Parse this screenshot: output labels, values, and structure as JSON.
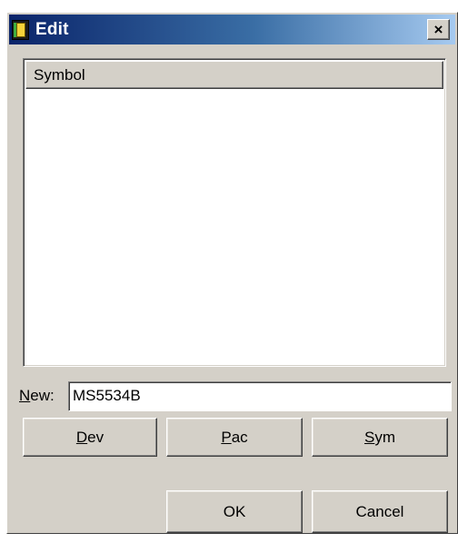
{
  "window": {
    "title": "Edit",
    "close_label": "×"
  },
  "list": {
    "column_header": "Symbol",
    "items": []
  },
  "new_field": {
    "label_mnemonic": "N",
    "label_rest": "ew:",
    "value": "MS5534B"
  },
  "buttons": {
    "dev": {
      "mnemonic": "D",
      "rest": "ev"
    },
    "pac": {
      "mnemonic": "P",
      "rest": "ac"
    },
    "sym": {
      "mnemonic": "S",
      "rest": "ym"
    },
    "ok": "OK",
    "cancel": "Cancel"
  },
  "colors": {
    "face": "#d4d0c8",
    "title_start": "#0a246a",
    "title_end": "#a6caf0"
  }
}
